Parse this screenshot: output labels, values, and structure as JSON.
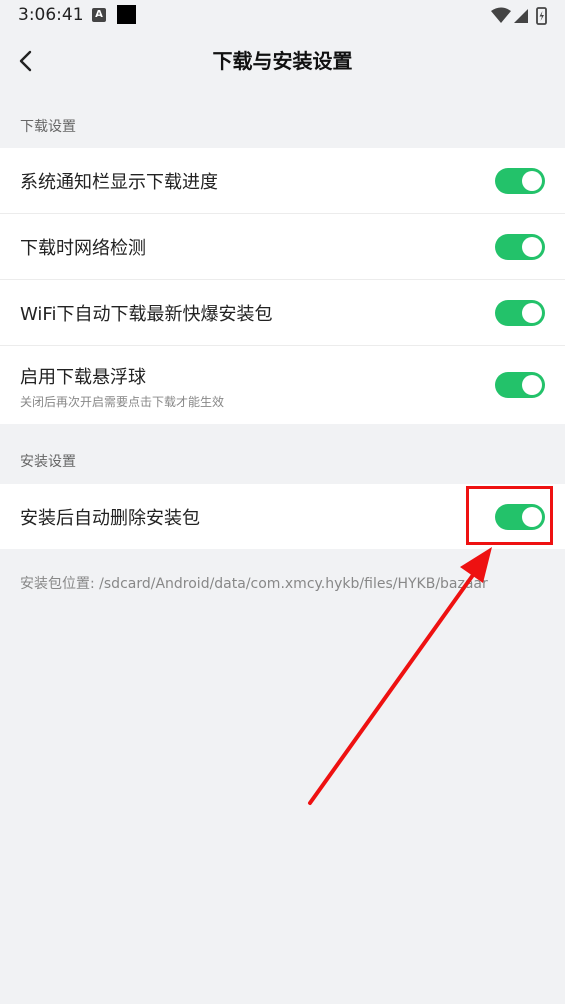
{
  "status_bar": {
    "time": "3:06:41",
    "icons": [
      "a-badge-icon",
      "black-square-icon",
      "wifi-icon",
      "signal-icon",
      "battery-charging-icon"
    ]
  },
  "header": {
    "title": "下载与安装设置",
    "back_icon": "chevron-left-icon"
  },
  "sections": {
    "download": {
      "label": "下载设置",
      "items": [
        {
          "label": "系统通知栏显示下载进度",
          "enabled": true
        },
        {
          "label": "下载时网络检测",
          "enabled": true
        },
        {
          "label": "WiFi下自动下载最新快爆安装包",
          "enabled": true
        },
        {
          "label": "启用下载悬浮球",
          "sublabel": "关闭后再次开启需要点击下载才能生效",
          "enabled": true
        }
      ]
    },
    "install": {
      "label": "安装设置",
      "items": [
        {
          "label": "安装后自动删除安装包",
          "enabled": true
        }
      ]
    }
  },
  "install_path": "安装包位置: /sdcard/Android/data/com.xmcy.hykb/files/HYKB/bazaar",
  "colors": {
    "accent": "#23c26a",
    "background": "#f1f2f4",
    "annotation": "#ee1111"
  }
}
